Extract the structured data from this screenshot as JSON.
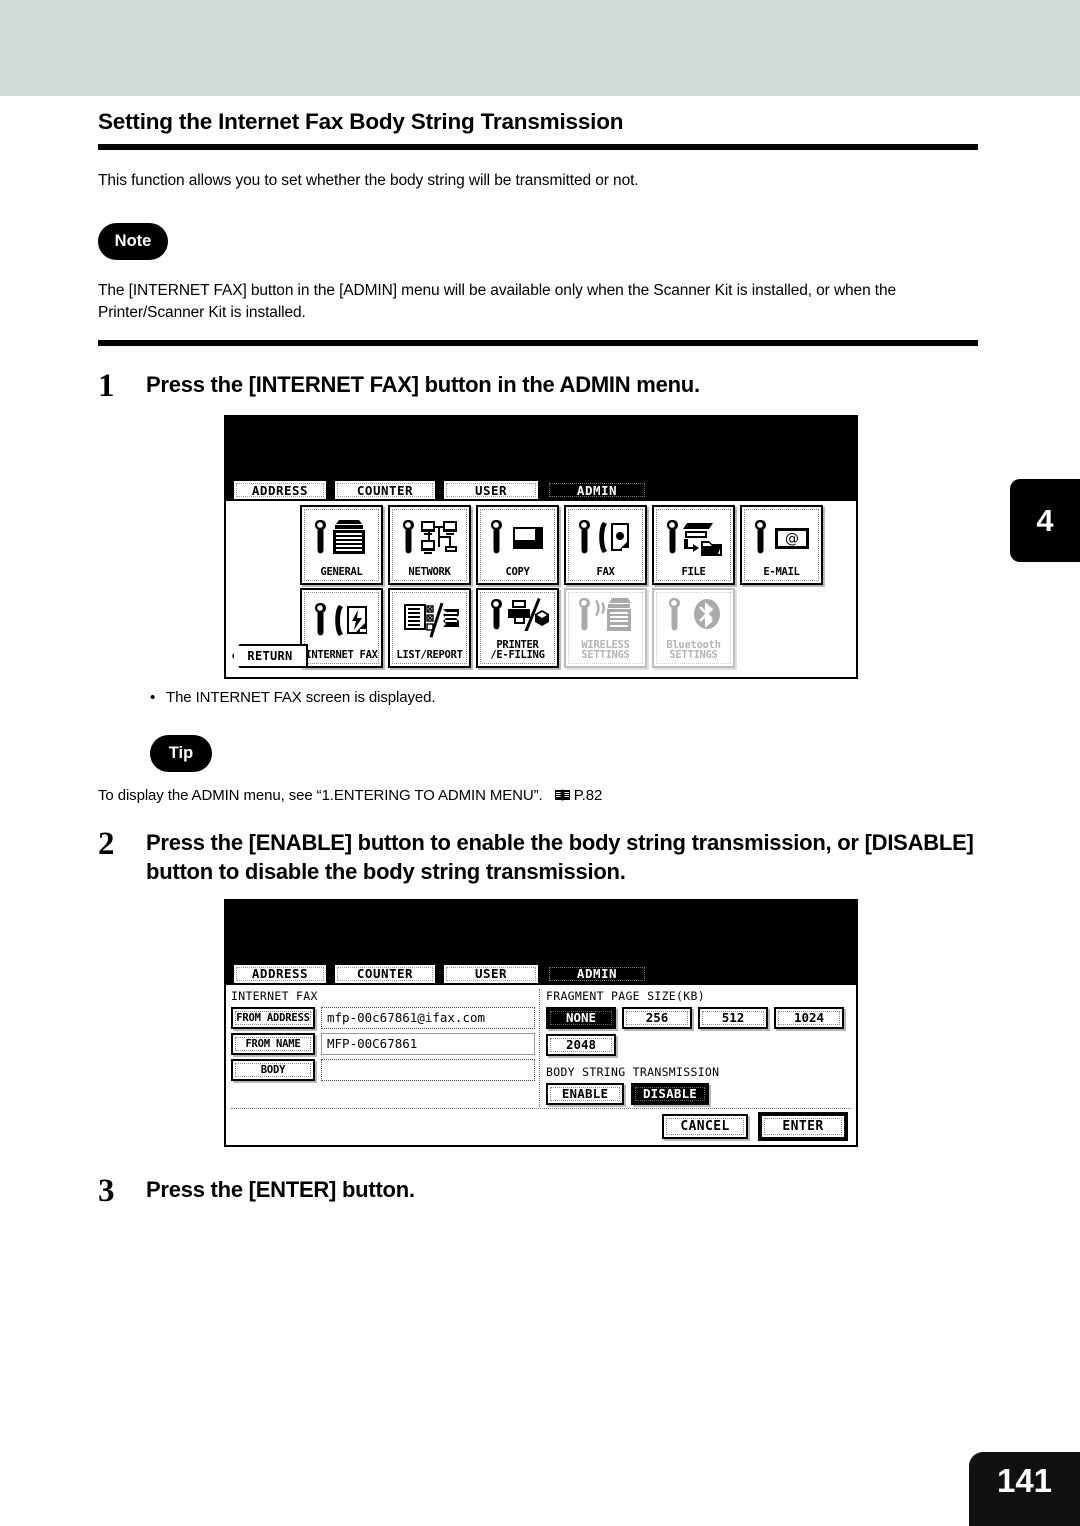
{
  "page": {
    "title": "Setting the Internet Fax Body String Transmission",
    "intro": "This function allows you to set whether the body string will be transmitted or not.",
    "note_badge": "Note",
    "note_text": "The [INTERNET FAX] button in the [ADMIN] menu will be available only when the Scanner Kit is installed, or when the Printer/Scanner Kit is installed.",
    "tip_badge": "Tip",
    "tip_text": "To display the ADMIN menu, see “1.ENTERING TO ADMIN MENU”.",
    "tip_ref": "P.82",
    "chapter_tab": "4",
    "page_number": "141"
  },
  "steps": [
    {
      "num": "1",
      "text": "Press the [INTERNET FAX] button in the ADMIN menu."
    },
    {
      "num": "2",
      "text": "Press the [ENABLE] button to enable the body string transmission, or [DISABLE] button to disable the body string transmission."
    },
    {
      "num": "3",
      "text": "Press the [ENTER] button."
    }
  ],
  "step1_result": "The INTERNET FAX screen is displayed.",
  "screen_admin": {
    "tabs": [
      {
        "label": "ADDRESS",
        "active": false
      },
      {
        "label": "COUNTER",
        "active": false
      },
      {
        "label": "USER",
        "active": false
      },
      {
        "label": "ADMIN",
        "active": true
      }
    ],
    "return_label": "RETURN",
    "row1": [
      {
        "label": "GENERAL",
        "icon": "wrench-copier-icon",
        "dim": false
      },
      {
        "label": "NETWORK",
        "icon": "wrench-network-icon",
        "dim": false
      },
      {
        "label": "COPY",
        "icon": "wrench-copy-icon",
        "dim": false
      },
      {
        "label": "FAX",
        "icon": "wrench-fax-icon",
        "dim": false
      },
      {
        "label": "FILE",
        "icon": "wrench-file-icon",
        "dim": false
      },
      {
        "label": "E-MAIL",
        "icon": "wrench-email-icon",
        "dim": false
      }
    ],
    "row2": [
      {
        "label": "INTERNET FAX",
        "icon": "wrench-internet-fax-icon",
        "dim": false
      },
      {
        "label": "LIST/REPORT",
        "icon": "list-report-icon",
        "dim": false
      },
      {
        "label": "PRINTER\n/E-FILING",
        "icon": "wrench-printer-efiling-icon",
        "dim": false
      },
      {
        "label": "WIRELESS\nSETTINGS",
        "icon": "wrench-wireless-icon",
        "dim": true
      },
      {
        "label": "Bluetooth\nSETTINGS",
        "icon": "wrench-bluetooth-icon",
        "dim": true
      }
    ]
  },
  "screen_ifax": {
    "tabs": [
      {
        "label": "ADDRESS",
        "active": false
      },
      {
        "label": "COUNTER",
        "active": false
      },
      {
        "label": "USER",
        "active": false
      },
      {
        "label": "ADMIN",
        "active": true
      }
    ],
    "section_title": "INTERNET FAX",
    "fields": [
      {
        "button": "FROM ADDRESS",
        "value": "mfp-00c67861@ifax.com"
      },
      {
        "button": "FROM NAME",
        "value": "MFP-00C67861"
      },
      {
        "button": "BODY",
        "value": ""
      }
    ],
    "fragment_label": "FRAGMENT PAGE SIZE(KB)",
    "fragment_options": [
      {
        "label": "NONE",
        "selected": true
      },
      {
        "label": "256",
        "selected": false
      },
      {
        "label": "512",
        "selected": false
      },
      {
        "label": "1024",
        "selected": false
      },
      {
        "label": "2048",
        "selected": false
      }
    ],
    "body_string_label": "BODY STRING TRANSMISSION",
    "body_string_options": [
      {
        "label": "ENABLE",
        "selected": false
      },
      {
        "label": "DISABLE",
        "selected": true
      }
    ],
    "cancel_label": "CANCEL",
    "enter_label": "ENTER"
  },
  "colors": {
    "band": "#d3dbd8",
    "ink": "#000000",
    "disabled": "#b4b4b4"
  }
}
